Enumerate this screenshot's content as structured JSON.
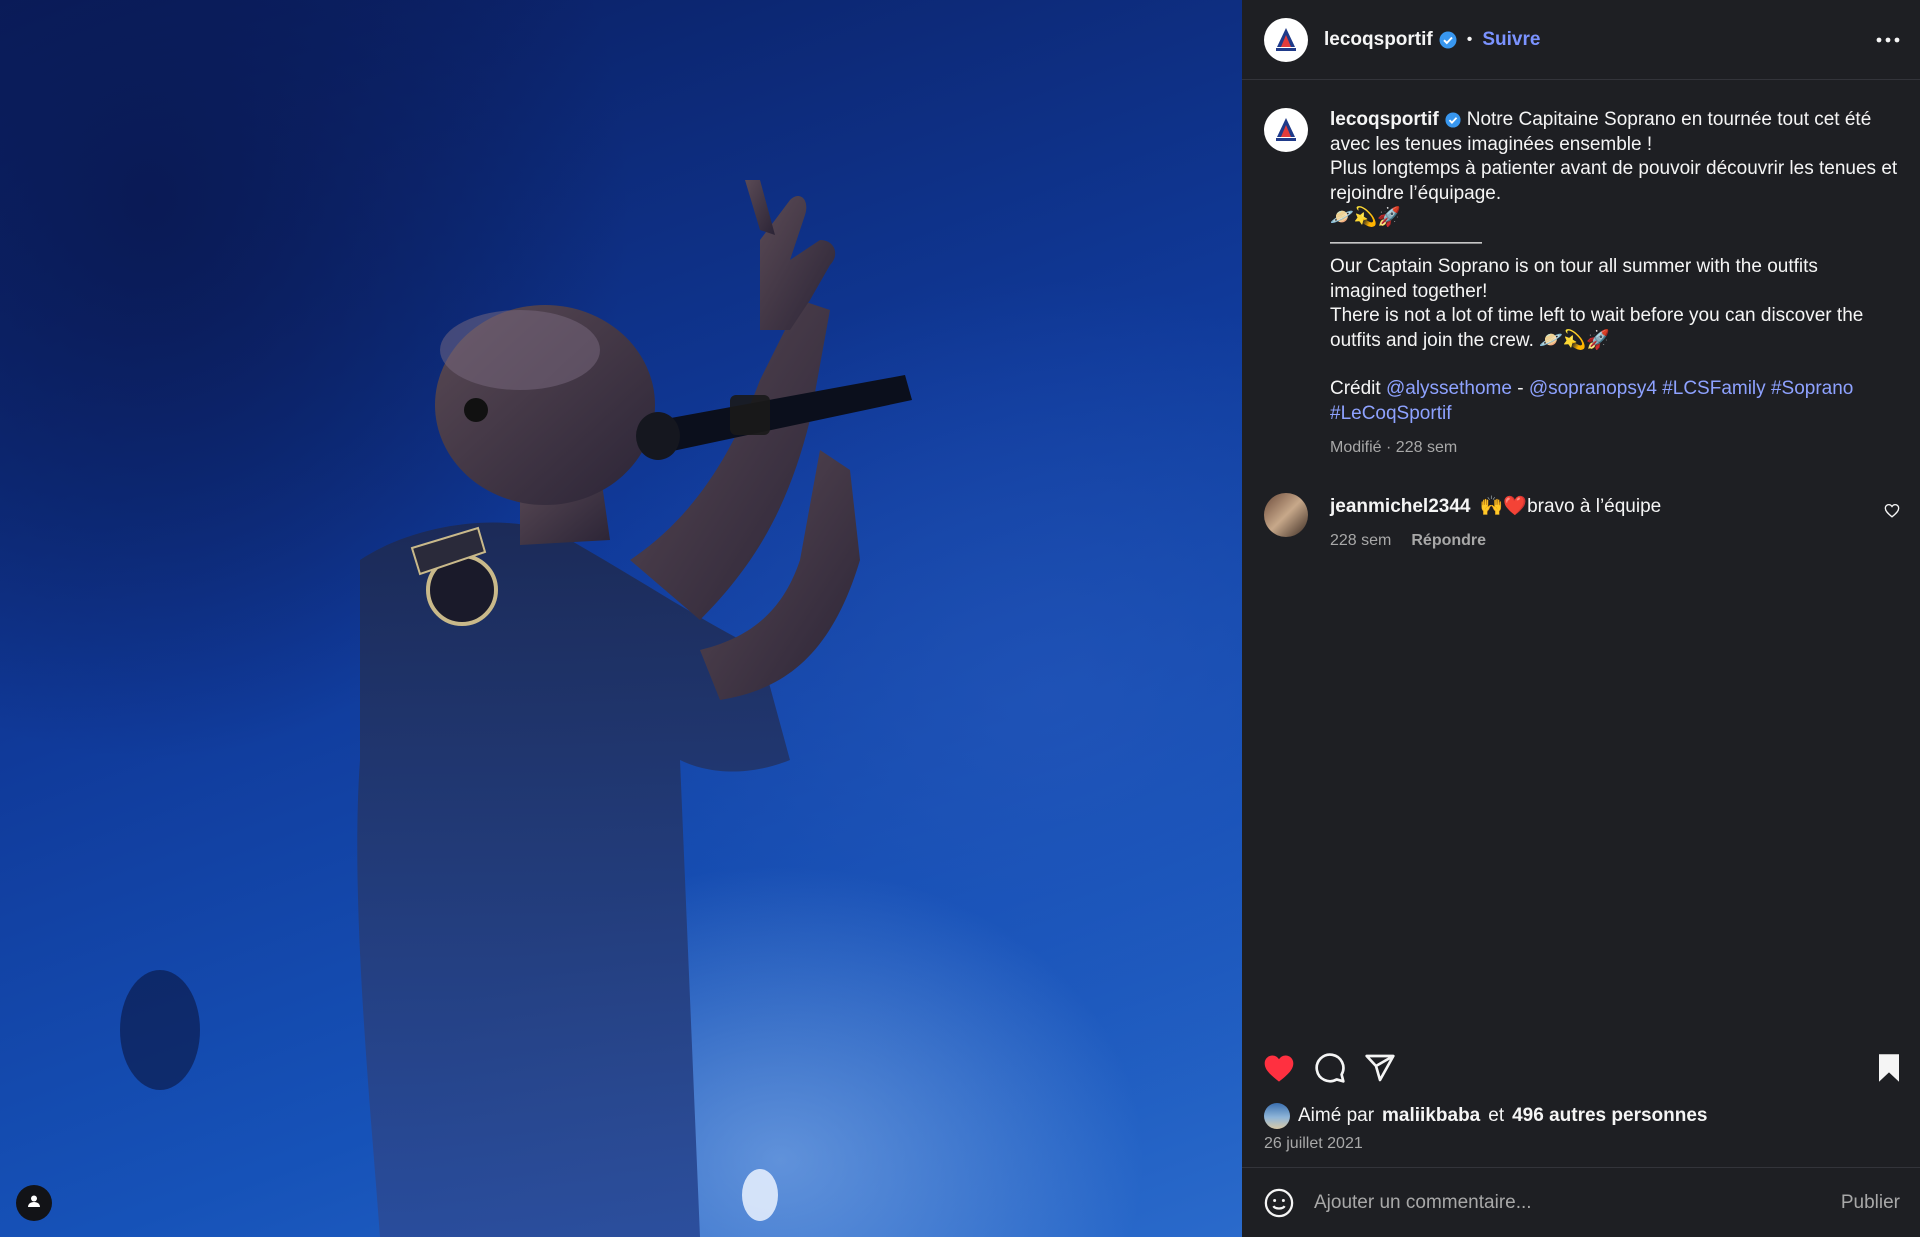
{
  "post": {
    "photo_alt": "",
    "author": {
      "username": "lecoqsportif",
      "verified": true,
      "follow_label": "Suivre",
      "separator": "•"
    },
    "caption": {
      "username": "lecoqsportif",
      "line1": "Notre Capitaine Soprano en tournée tout cet été avec les tenues imaginées ensemble !",
      "line2": "Plus longtemps à patienter avant de pouvoir découvrir les tenues et rejoindre l’équipage.",
      "emoji1": "🪐💫🚀",
      "divider": "————————",
      "line3": "Our Captain Soprano is on tour all summer with the outfits imagined together!",
      "line4": "There is not a lot of time left to wait before you can discover the outfits and join the crew. 🪐💫🚀",
      "credit_label": "Crédit",
      "credit_mention1": "@alyssethome",
      "credit_dash": "-",
      "credit_mention2": "@sopranopsy4",
      "tag1": "#LCSFamily",
      "tag2": "#Soprano",
      "tag3": "#LeCoqSportif",
      "meta": "Modifié · 228 sem"
    },
    "comments": [
      {
        "username": "jeanmichel2344",
        "text": "🙌❤️bravo à l’équipe",
        "time": "228 sem",
        "reply_label": "Répondre"
      }
    ],
    "likes": {
      "prefix": "Aimé par",
      "user": "maliikbaba",
      "middle": "et",
      "others": "496 autres personnes"
    },
    "date": "26 juillet 2021",
    "add_comment": {
      "placeholder": "Ajouter un commentaire...",
      "publish_label": "Publier"
    },
    "icons": {
      "like": "heart-filled-icon",
      "comment": "comment-icon",
      "share": "send-icon",
      "save": "bookmark-filled-icon",
      "more": "more-horizontal-icon",
      "emoji": "emoji-icon",
      "tag": "user-tag-icon"
    },
    "colors": {
      "accent": "#7b93ff",
      "like": "#ff3040",
      "panel_bg": "#1e1f23"
    }
  }
}
